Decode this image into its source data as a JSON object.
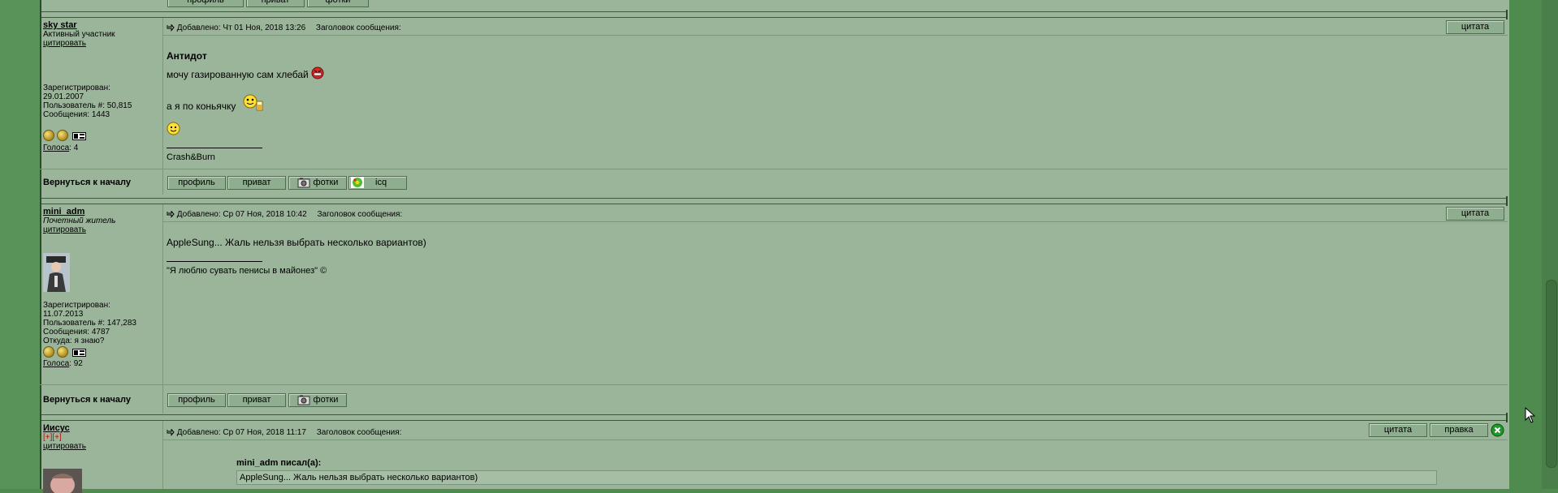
{
  "posts": [
    {
      "author": "sky star",
      "rank": "Активный участник",
      "quote_link": "цитировать",
      "registered_label": "Зарегистрирован:",
      "registered_date": "29.01.2007",
      "user_num": "Пользователь #: 50,815",
      "messages": "Сообщения: 1443",
      "votes_label": "Голоса",
      "votes_value": ": 4",
      "posted": "Добавлено: Чт 01 Ноя, 2018 13:26",
      "subject_label": "Заголовок сообщения:",
      "quote_btn": "цитата",
      "title": "Антидот",
      "line1": "мочу газированную сам хлебай",
      "line2": "а я по коньячку",
      "signature": "Crash&Burn",
      "back_label": "Вернуться к началу",
      "buttons": [
        "профиль",
        "приват",
        "фотки",
        "icq"
      ]
    },
    {
      "author": "mini_adm",
      "rank": "Почетный житель",
      "quote_link": "цитировать",
      "registered_label": "Зарегистрирован:",
      "registered_date": "11.07.2013",
      "user_num": "Пользователь #: 147,283",
      "messages": "Сообщения: 4787",
      "location": "Откуда: я знаю?",
      "votes_label": "Голоса",
      "votes_value": ": 92",
      "posted": "Добавлено: Ср 07 Ноя, 2018 10:42",
      "subject_label": "Заголовок сообщения:",
      "quote_btn": "цитата",
      "line1": "AppleSung... Жаль нельзя выбрать несколько вариантов)",
      "signature": "\"Я люблю сувать пенисы в майонез\" ©",
      "back_label": "Вернуться к началу",
      "buttons": [
        "профиль",
        "приват",
        "фотки"
      ]
    },
    {
      "author": "Иисус",
      "rank": "[+][+]",
      "quote_link": "цитировать",
      "posted": "Добавлено: Ср 07 Ноя, 2018 11:17",
      "subject_label": "Заголовок сообщения:",
      "quote_btn": "цитата",
      "edit_btn": "правка",
      "quoted_author": "mini_adm писал(а):",
      "quoted_text": "AppleSung... Жаль нельзя выбрать несколько вариантов)"
    }
  ],
  "top_buttons": [
    "профиль",
    "приват",
    "фотки"
  ],
  "colors": {
    "page_bg": "#4f8a4f",
    "forum_bg": "#9bb59b",
    "border": "#2e4a2e"
  }
}
